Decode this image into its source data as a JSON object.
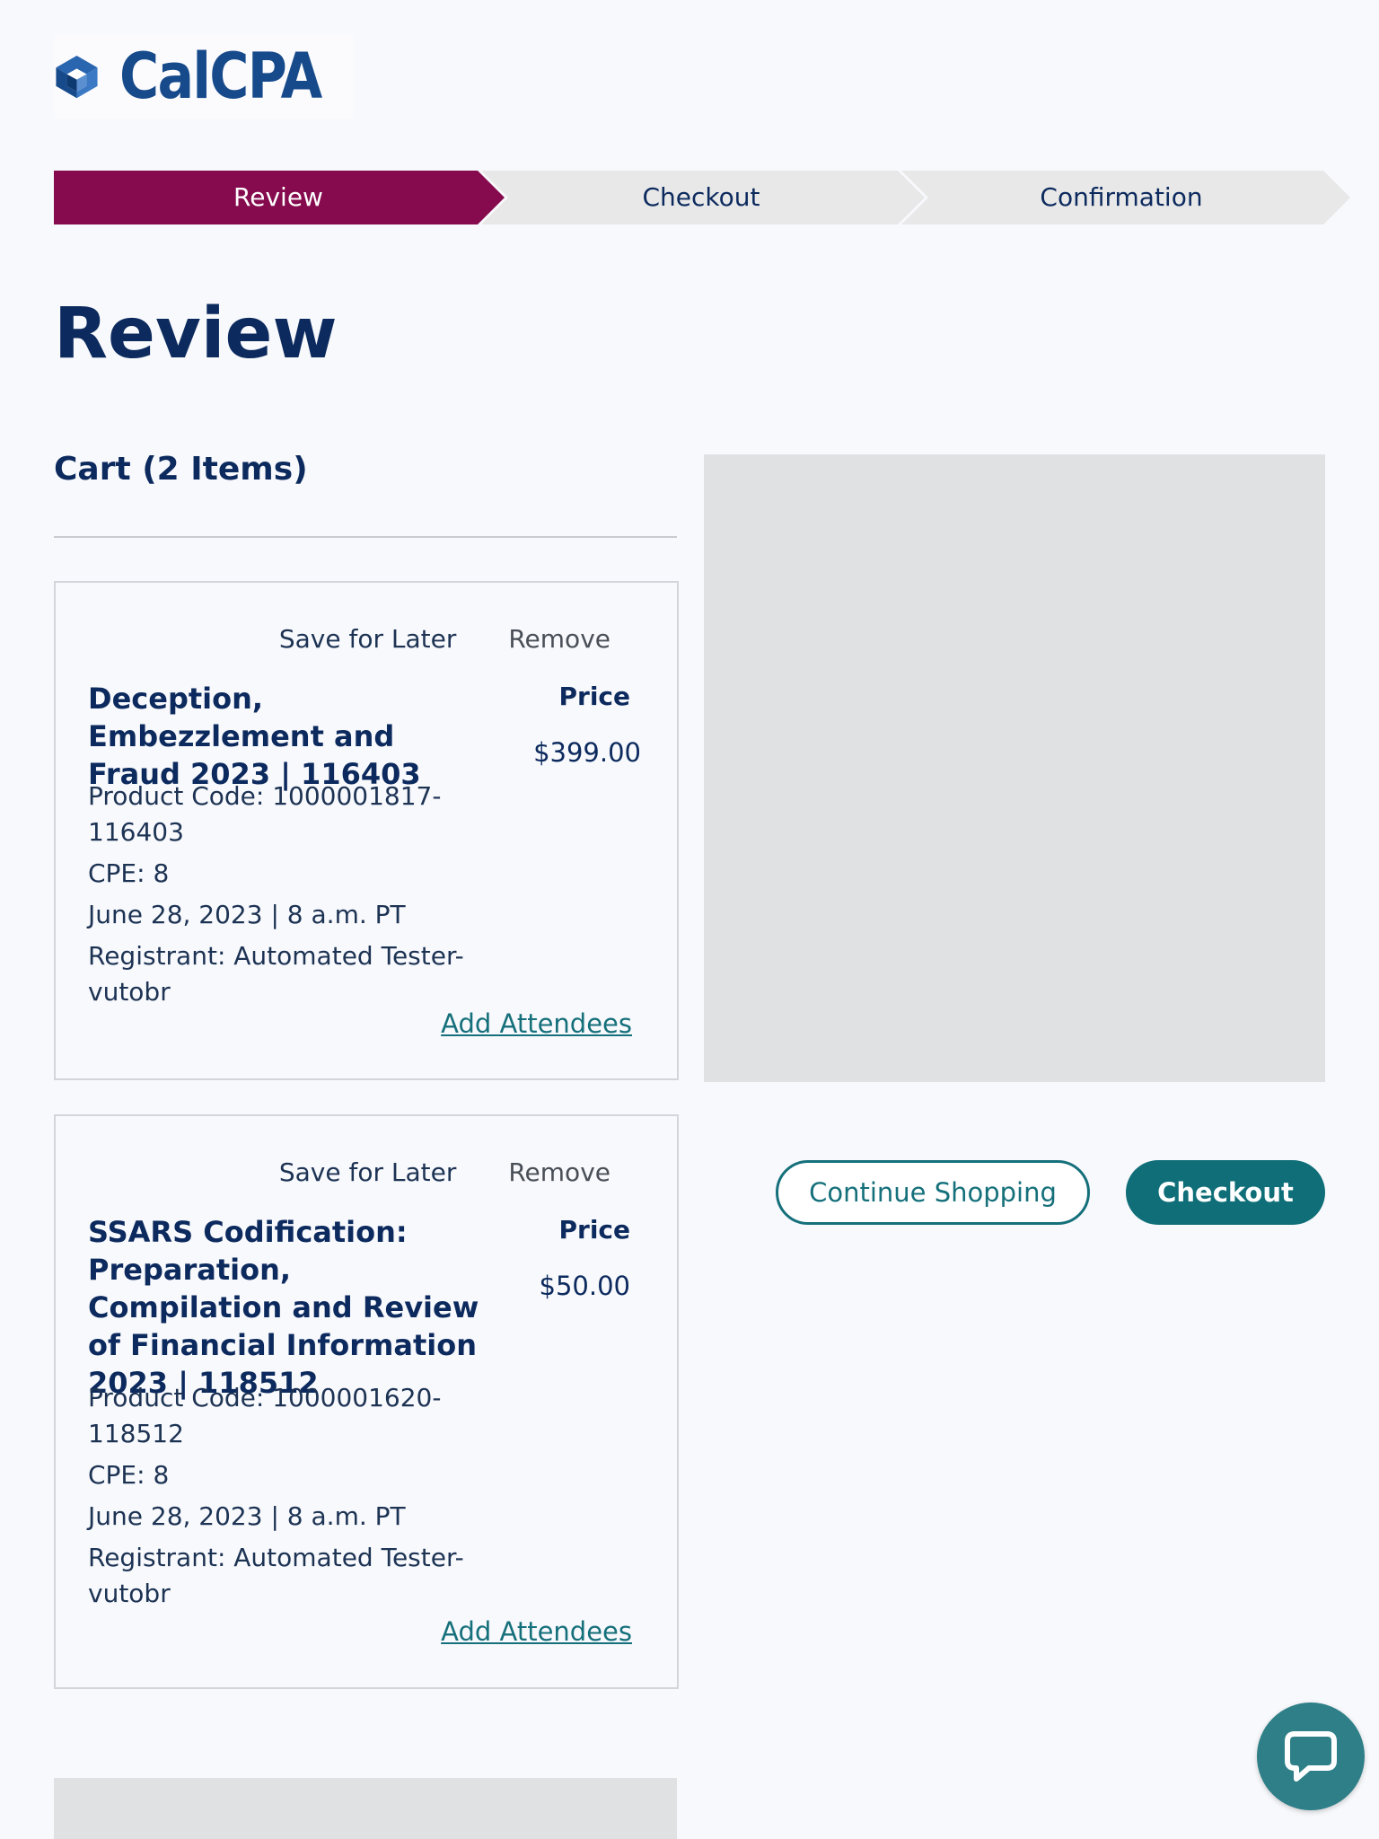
{
  "brand": {
    "name": "CalCPA",
    "color": "#174a8b"
  },
  "steps": [
    {
      "label": "Review",
      "state": "active",
      "color": "#850b4e"
    },
    {
      "label": "Checkout",
      "state": "inactive",
      "color": "#e8e8e8"
    },
    {
      "label": "Confirmation",
      "state": "inactive",
      "color": "#e8e8e8"
    }
  ],
  "page": {
    "title": "Review"
  },
  "cart": {
    "heading": "Cart (2 Items)",
    "items": [
      {
        "save_label": "Save for Later",
        "remove_label": "Remove",
        "title": "Deception, Embezzlement and Fraud 2023 | 116403",
        "product_code": "Product Code: 1000001817-116403",
        "cpe": "CPE: 8",
        "date": "June 28, 2023 | 8 a.m. PT",
        "registrant": "Registrant: Automated Tester-vutobr",
        "price_label": "Price",
        "price": "$399.00",
        "add_attendees_label": "Add Attendees"
      },
      {
        "save_label": "Save for Later",
        "remove_label": "Remove",
        "title": "SSARS Codification: Preparation, Compilation and Review of Financial Information 2023 | 118512",
        "product_code": "Product Code: 1000001620-118512",
        "cpe": "CPE: 8",
        "date": "June 28, 2023 | 8 a.m. PT",
        "registrant": "Registrant: Automated Tester-vutobr",
        "price_label": "Price",
        "price": "$50.00",
        "add_attendees_label": "Add Attendees"
      }
    ]
  },
  "actions": {
    "continue_label": "Continue Shopping",
    "checkout_label": "Checkout",
    "accent_color": "#15707b"
  },
  "chat": {
    "icon": "chat-bubble-icon"
  }
}
